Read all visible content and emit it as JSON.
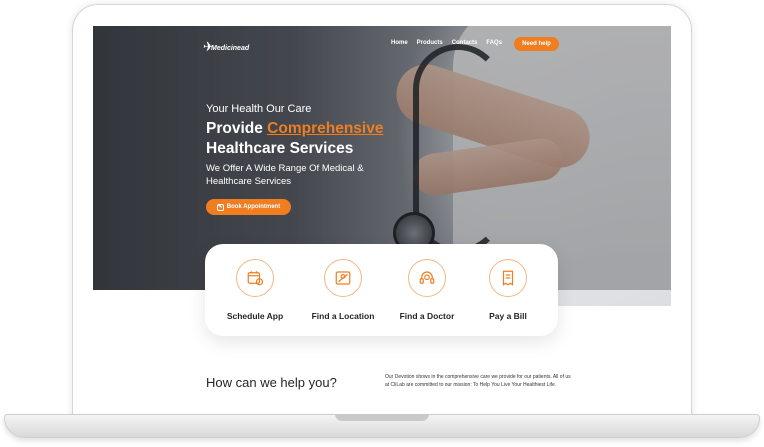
{
  "nav": {
    "brand": "Medicinead",
    "links": [
      "Home",
      "Products",
      "Contacts",
      "FAQs"
    ],
    "cta": "Need help"
  },
  "hero": {
    "tagline": "Your Health Our Care",
    "headline_prefix": "Provide",
    "headline_accent": "Comprehensive",
    "headline_rest": "Healthcare Services",
    "subtext": "We Offer A Wide Range Of Medical & Healthcare Services",
    "button": "Book Appointment"
  },
  "services": [
    {
      "label": "Schedule App",
      "icon": "calendar-icon"
    },
    {
      "label": "Find a Location",
      "icon": "map-icon"
    },
    {
      "label": "Find a Doctor",
      "icon": "headset-icon"
    },
    {
      "label": "Pay a Bill",
      "icon": "receipt-icon"
    }
  ],
  "help": {
    "title": "How can we help you?",
    "text": "Our Devotion shows in the comprehensive care we provide for our patients. All of us at CliLab are committed to our mission: To Help You Live Your Healthiest Life."
  },
  "colors": {
    "accent": "#f07d20",
    "text": "#1f2328"
  }
}
